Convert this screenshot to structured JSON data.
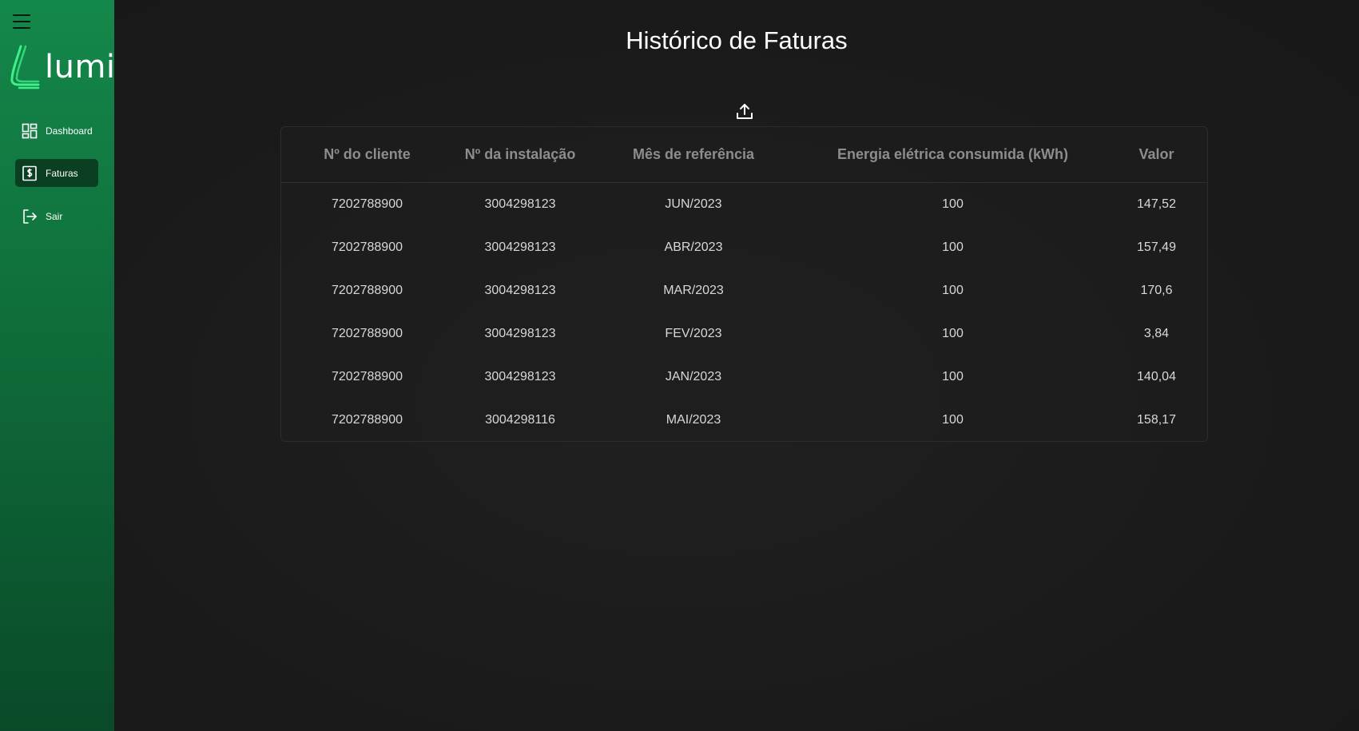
{
  "sidebar": {
    "logo_text": "lumi",
    "items": [
      {
        "label": "Dashboard",
        "icon": "dashboard-grid-icon",
        "active": false
      },
      {
        "label": "Faturas",
        "icon": "invoice-dollar-icon",
        "active": true
      },
      {
        "label": "Sair",
        "icon": "logout-icon",
        "active": false
      }
    ]
  },
  "main": {
    "title": "Histórico de Faturas",
    "upload_icon": "upload-icon",
    "table": {
      "headers": [
        "Nº do cliente",
        "Nº da instalação",
        "Mês de referência",
        "Energia elétrica consumida (kWh)",
        "Valor"
      ],
      "rows": [
        [
          "7202788900",
          "3004298123",
          "JUN/2023",
          "100",
          "147,52"
        ],
        [
          "7202788900",
          "3004298123",
          "ABR/2023",
          "100",
          "157,49"
        ],
        [
          "7202788900",
          "3004298123",
          "MAR/2023",
          "100",
          "170,6"
        ],
        [
          "7202788900",
          "3004298123",
          "FEV/2023",
          "100",
          "3,84"
        ],
        [
          "7202788900",
          "3004298123",
          "JAN/2023",
          "100",
          "140,04"
        ],
        [
          "7202788900",
          "3004298116",
          "MAI/2023",
          "100",
          "158,17"
        ]
      ]
    }
  },
  "colors": {
    "sidebar_top": "#14884a",
    "sidebar_bottom": "#0a4a28",
    "active_item": "#0b3f22",
    "logo_accent": "#3ef08a",
    "background": "#1b1b1b"
  }
}
